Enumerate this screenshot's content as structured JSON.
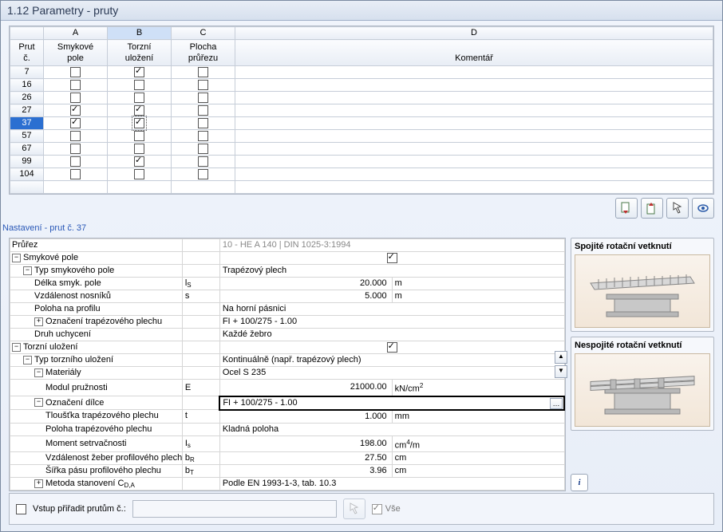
{
  "title": "1.12 Parametry - pruty",
  "grid": {
    "colLetters": [
      "A",
      "B",
      "C",
      "D"
    ],
    "h1": "Prut\nč.",
    "hA": "Smykové\npole",
    "hB": "Torzní\nuložení",
    "hC": "Plocha\nprůřezu",
    "hD": "Komentář",
    "rows": [
      {
        "n": "7",
        "a": false,
        "b": true,
        "c": false,
        "sel": false
      },
      {
        "n": "16",
        "a": false,
        "b": false,
        "c": false,
        "sel": false
      },
      {
        "n": "26",
        "a": false,
        "b": false,
        "c": false,
        "sel": false
      },
      {
        "n": "27",
        "a": true,
        "b": true,
        "c": false,
        "sel": false
      },
      {
        "n": "37",
        "a": true,
        "b": true,
        "c": false,
        "sel": true,
        "dotted": true
      },
      {
        "n": "57",
        "a": false,
        "b": false,
        "c": false,
        "sel": false
      },
      {
        "n": "67",
        "a": false,
        "b": false,
        "c": false,
        "sel": false
      },
      {
        "n": "99",
        "a": false,
        "b": true,
        "c": false,
        "sel": false
      },
      {
        "n": "104",
        "a": false,
        "b": false,
        "c": false,
        "sel": false
      }
    ]
  },
  "settings_label": "Nastavení - prut č. 37",
  "props": [
    {
      "lvl": 0,
      "exp": null,
      "label": "Průřez",
      "sym": "",
      "val": "10 - HE A 140 | DIN 1025-3:1994",
      "unit": "",
      "gray": true,
      "full": true
    },
    {
      "lvl": 0,
      "exp": "-",
      "label": "Smykové pole",
      "sym": "",
      "val": "[cb:on]",
      "unit": "",
      "full": true,
      "center": true
    },
    {
      "lvl": 1,
      "exp": "-",
      "label": "Typ smykového pole",
      "sym": "",
      "val": "Trapézový plech",
      "unit": "",
      "full": true
    },
    {
      "lvl": 2,
      "exp": null,
      "label": "Délka smyk. pole",
      "sym": "l<sub>S</sub>",
      "val": "20.000",
      "unit": "m"
    },
    {
      "lvl": 2,
      "exp": null,
      "label": "Vzdálenost nosníků",
      "sym": "s",
      "val": "5.000",
      "unit": "m"
    },
    {
      "lvl": 2,
      "exp": null,
      "label": "Poloha na profilu",
      "sym": "",
      "val": "Na horní pásnici",
      "unit": "",
      "full": true
    },
    {
      "lvl": 2,
      "exp": "+",
      "label": "Označení trapézového plechu",
      "sym": "",
      "val": "FI + 100/275 - 1.00",
      "unit": "",
      "full": true
    },
    {
      "lvl": 2,
      "exp": null,
      "label": "Druh uchycení",
      "sym": "",
      "val": "Každé žebro",
      "unit": "",
      "full": true
    },
    {
      "lvl": 0,
      "exp": "-",
      "label": "Torzní uložení",
      "sym": "",
      "val": "[cb:on]",
      "unit": "",
      "full": true,
      "center": true
    },
    {
      "lvl": 1,
      "exp": "-",
      "label": "Typ torzního uložení",
      "sym": "",
      "val": "Kontinuálně (např. trapézový plech)",
      "unit": "",
      "full": true
    },
    {
      "lvl": 2,
      "exp": "-",
      "label": "Materiály",
      "sym": "",
      "val": "Ocel S 235",
      "unit": "",
      "full": true
    },
    {
      "lvl": 3,
      "exp": null,
      "label": "Modul pružnosti",
      "sym": "E",
      "val": "21000.00",
      "unit": "kN/cm<sup>2</sup>"
    },
    {
      "lvl": 2,
      "exp": "-",
      "label": "Označení dílce",
      "sym": "",
      "val": "FI + 100/275 - 1.00",
      "unit": "",
      "full": true,
      "select": true
    },
    {
      "lvl": 3,
      "exp": null,
      "label": "Tloušťka trapézového plechu",
      "sym": "t",
      "val": "1.000",
      "unit": "mm"
    },
    {
      "lvl": 3,
      "exp": null,
      "label": "Poloha trapézového plechu",
      "sym": "",
      "val": "Kladná poloha",
      "unit": "",
      "full": true
    },
    {
      "lvl": 3,
      "exp": null,
      "label": "Moment setrvačnosti",
      "sym": "I<sub>s</sub>",
      "val": "198.00",
      "unit": "cm<sup>4</sup>/m"
    },
    {
      "lvl": 3,
      "exp": null,
      "label": "Vzdálenost žeber profilového plechu",
      "sym": "b<sub>R</sub>",
      "val": "27.50",
      "unit": "cm"
    },
    {
      "lvl": 3,
      "exp": null,
      "label": "Šířka pásu profilového plechu",
      "sym": "b<sub>T</sub>",
      "val": "3.96",
      "unit": "cm"
    },
    {
      "lvl": 2,
      "exp": "+",
      "label": "Metoda stanovení C<sub>D,A</sub>",
      "sym": "",
      "val": "Podle EN 1993-1-3, tab. 10.3",
      "unit": "",
      "full": true
    }
  ],
  "side": {
    "cap1": "Spojité rotační vetknutí",
    "cap2": "Nespojité rotační vetknutí"
  },
  "bottom": {
    "assign": "Vstup přiřadit prutům č.:",
    "all": "Vše"
  }
}
